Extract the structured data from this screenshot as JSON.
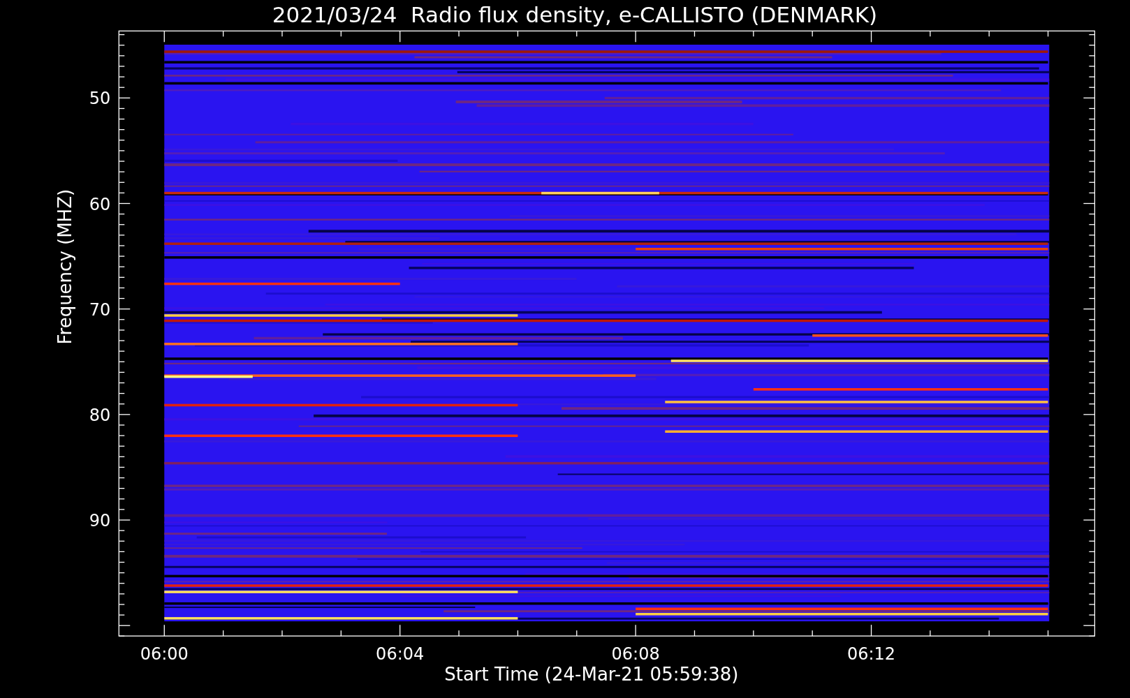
{
  "title": "2021/03/24  Radio flux density, e-CALLISTO (DENMARK)",
  "y_axis": {
    "label": "Frequency (MHZ)",
    "ticks": [
      "50",
      "60",
      "70",
      "80",
      "90"
    ]
  },
  "x_axis": {
    "label": "Start Time (24-Mar-21 05:59:38)",
    "ticks": [
      "06:00",
      "06:04",
      "06:08",
      "06:12"
    ]
  }
}
